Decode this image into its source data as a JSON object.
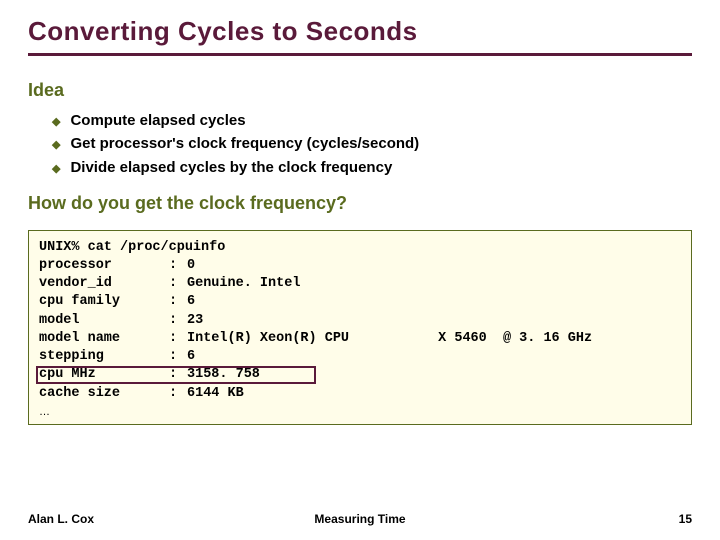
{
  "title": "Converting Cycles to Seconds",
  "section1": "Idea",
  "bullets": [
    "Compute elapsed cycles",
    "Get processor's clock frequency (cycles/second)",
    "Divide elapsed cycles by the clock frequency"
  ],
  "question": "How do you get the clock frequency?",
  "code": {
    "command": "UNIX% cat /proc/cpuinfo",
    "rows": [
      {
        "key": "processor",
        "val": "0"
      },
      {
        "key": "vendor_id",
        "val": "Genuine. Intel"
      },
      {
        "key": "cpu family",
        "val": "6"
      },
      {
        "key": "model",
        "val": "23"
      },
      {
        "key": "model name",
        "val": "Intel(R) Xeon(R) CPU           X 5460  @ 3. 16 GHz"
      },
      {
        "key": "stepping",
        "val": "6"
      },
      {
        "key": "cpu MHz",
        "val": "3158. 758"
      },
      {
        "key": "cache size",
        "val": "6144 KB"
      }
    ],
    "ellipsis": "…"
  },
  "footer": {
    "left": "Alan L. Cox",
    "center": "Measuring Time",
    "right": "15"
  }
}
